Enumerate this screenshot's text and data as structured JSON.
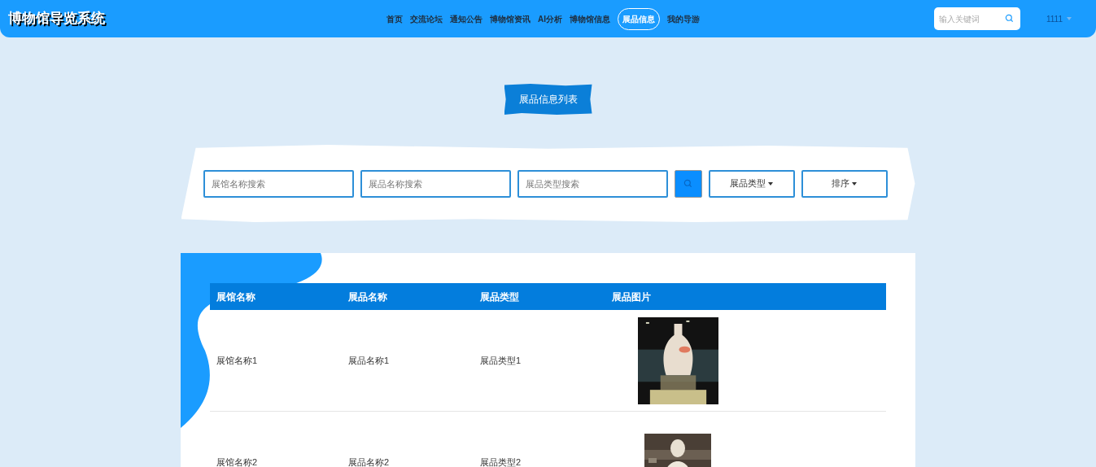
{
  "header": {
    "title": "博物馆导览系统",
    "nav": [
      {
        "label": "首页",
        "selected": false
      },
      {
        "label": "交流论坛",
        "selected": false
      },
      {
        "label": "通知公告",
        "selected": false
      },
      {
        "label": "博物馆资讯",
        "selected": false
      },
      {
        "label": "AI分析",
        "selected": false
      },
      {
        "label": "博物馆信息",
        "selected": false
      },
      {
        "label": "展品信息",
        "selected": true
      },
      {
        "label": "我的导游",
        "selected": false
      }
    ],
    "search": {
      "placeholder": "输入关键词"
    },
    "user": "1111"
  },
  "page_title": "展品信息列表",
  "filters": {
    "fields": [
      {
        "placeholder": "展馆名称搜索"
      },
      {
        "placeholder": "展品名称搜索"
      },
      {
        "placeholder": "展品类型搜索"
      }
    ],
    "dropdowns": [
      "展品类型",
      "排序"
    ]
  },
  "table": {
    "columns": [
      "展馆名称",
      "展品名称",
      "展品类型",
      "展品图片"
    ],
    "rows": [
      {
        "cells": [
          "展馆名称1",
          "展品名称1",
          "展品类型1"
        ],
        "picture": {
          "kind": "picture"
        }
      },
      {
        "cells": [
          "展馆名称2",
          "展品名称2",
          "展品类型2"
        ],
        "picture": {
          "kind": "picture"
        }
      }
    ]
  }
}
